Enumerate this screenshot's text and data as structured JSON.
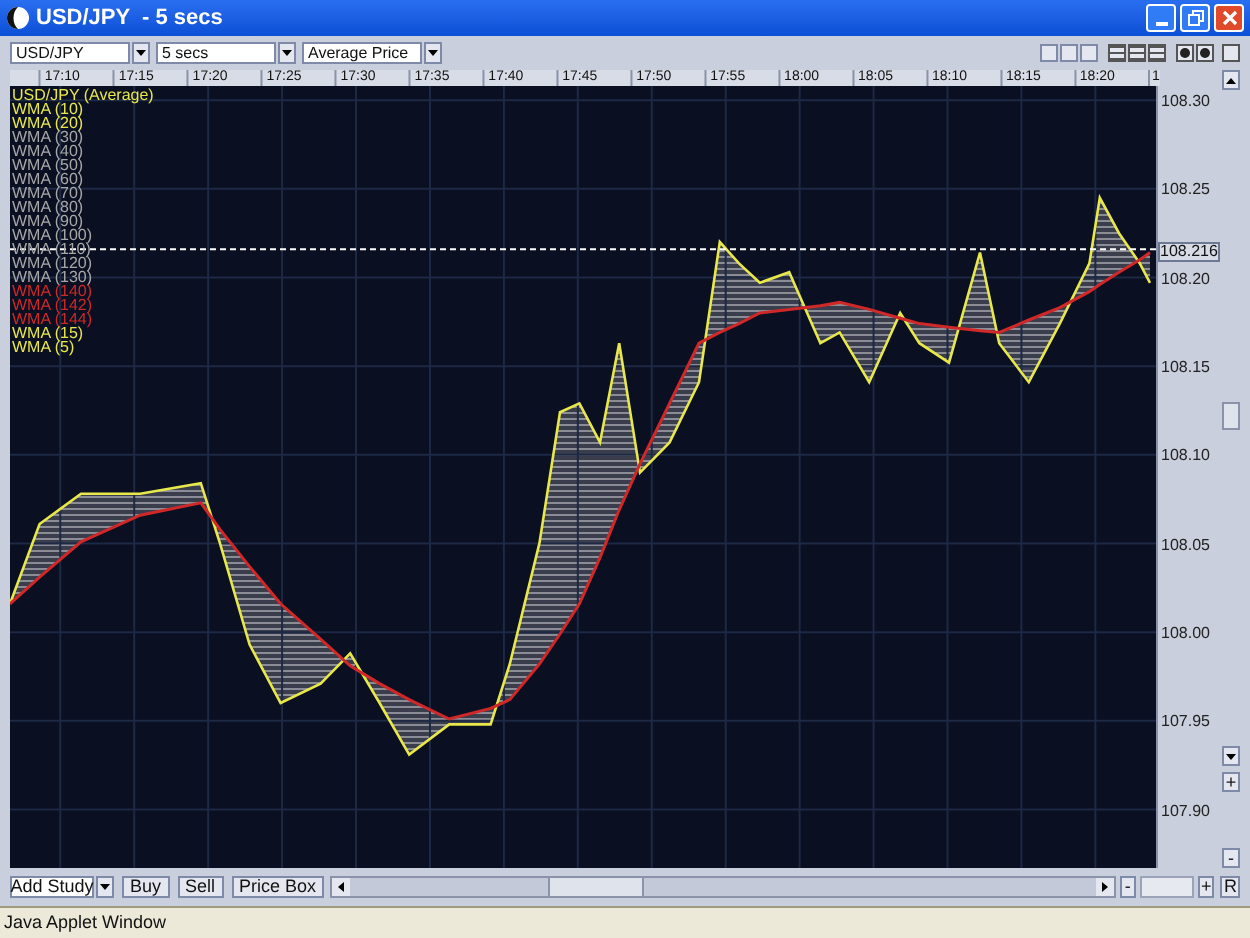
{
  "window": {
    "title": "USD/JPY  - 5 secs"
  },
  "toolbar": {
    "symbol": "USD/JPY",
    "interval": "5 secs",
    "price_type": "Average Price"
  },
  "legend": [
    {
      "kind": "series"
    },
    {
      "kind": "label",
      "label": "WMA (10)",
      "color": "#e8e84a"
    },
    {
      "kind": "label",
      "label": "WMA (20)",
      "color": "#e8e84a"
    },
    {
      "kind": "label",
      "label": "WMA (30)",
      "color": "#a8a8a8"
    },
    {
      "kind": "label",
      "label": "WMA (40)",
      "color": "#a8a8a8"
    },
    {
      "kind": "label",
      "label": "WMA (50)",
      "color": "#a8a8a8"
    },
    {
      "kind": "label",
      "label": "WMA (60)",
      "color": "#a8a8a8"
    },
    {
      "kind": "label",
      "label": "WMA (70)",
      "color": "#a8a8a8"
    },
    {
      "kind": "label",
      "label": "WMA (80)",
      "color": "#a8a8a8"
    },
    {
      "kind": "label",
      "label": "WMA (90)",
      "color": "#a8a8a8"
    },
    {
      "kind": "label",
      "label": "WMA (100)",
      "color": "#a8a8a8"
    },
    {
      "kind": "label",
      "label": "WMA (110)",
      "color": "#a8a8a8"
    },
    {
      "kind": "label",
      "label": "WMA (120)",
      "color": "#a8a8a8"
    },
    {
      "kind": "label",
      "label": "WMA (130)",
      "color": "#a8a8a8"
    },
    {
      "kind": "label",
      "label": "WMA (140)",
      "color": "#d02828"
    },
    {
      "kind": "label",
      "label": "WMA (142)",
      "color": "#d02828"
    },
    {
      "kind": "series"
    },
    {
      "kind": "label",
      "label": "WMA (15)",
      "color": "#e8e84a"
    },
    {
      "kind": "label",
      "label": "WMA (5)",
      "color": "#e8e84a"
    }
  ],
  "chart_data": {
    "type": "line",
    "grid": true,
    "xlim": [
      1026.6,
      1104.1
    ],
    "ylim": [
      107.867,
      108.308
    ],
    "x": [
      1026.6,
      1028.6,
      1031.4,
      1035.4,
      1039.5,
      1040.8,
      1042.8,
      1044.9,
      1047.6,
      1049.6,
      1051.6,
      1053.6,
      1056.3,
      1059.1,
      1060.4,
      1062.4,
      1063.8,
      1065.1,
      1066.5,
      1067.8,
      1069.2,
      1071.2,
      1073.2,
      1074.6,
      1075.9,
      1077.3,
      1079.3,
      1081.4,
      1082.7,
      1084.7,
      1086.8,
      1088.1,
      1090.1,
      1092.2,
      1093.5,
      1095.5,
      1097.6,
      1099.6,
      1100.3,
      1101.6,
      1103.0,
      1103.7
    ],
    "series": [
      {
        "name": "USD/JPY (Average)",
        "color": "#e8e84a",
        "values": [
          108.016,
          108.061,
          108.078,
          108.078,
          108.084,
          108.05,
          107.993,
          107.96,
          107.971,
          107.988,
          107.96,
          107.931,
          107.948,
          107.948,
          107.982,
          108.05,
          108.124,
          108.129,
          108.107,
          108.163,
          108.09,
          108.107,
          108.141,
          108.22,
          108.208,
          108.197,
          108.203,
          108.163,
          108.169,
          108.141,
          108.18,
          108.163,
          108.152,
          108.214,
          108.163,
          108.141,
          108.174,
          108.208,
          108.245,
          108.225,
          108.208,
          108.197
        ]
      },
      {
        "name": "WMA (144)",
        "color": "#d02828",
        "values": [
          108.016,
          108.031,
          108.051,
          108.066,
          108.073,
          108.058,
          108.037,
          108.016,
          107.996,
          107.981,
          107.971,
          107.962,
          107.951,
          107.957,
          107.962,
          107.982,
          107.999,
          108.016,
          108.042,
          108.069,
          108.095,
          108.129,
          108.163,
          108.169,
          108.174,
          108.18,
          108.182,
          108.184,
          108.186,
          108.182,
          108.177,
          108.174,
          108.172,
          108.17,
          108.169,
          108.176,
          108.183,
          108.192,
          108.196,
          108.203,
          108.21,
          108.214
        ]
      }
    ],
    "xticks": [
      {
        "value": 1030,
        "label": "17:10"
      },
      {
        "value": 1035,
        "label": "17:15"
      },
      {
        "value": 1040,
        "label": "17:20"
      },
      {
        "value": 1045,
        "label": "17:25"
      },
      {
        "value": 1050,
        "label": "17:30"
      },
      {
        "value": 1055,
        "label": "17:35"
      },
      {
        "value": 1060,
        "label": "17:40"
      },
      {
        "value": 1065,
        "label": "17:45"
      },
      {
        "value": 1070,
        "label": "17:50"
      },
      {
        "value": 1075,
        "label": "17:55"
      },
      {
        "value": 1080,
        "label": "18:00"
      },
      {
        "value": 1085,
        "label": "18:05"
      },
      {
        "value": 1090,
        "label": "18:10"
      },
      {
        "value": 1095,
        "label": "18:15"
      },
      {
        "value": 1100,
        "label": "18:20"
      }
    ],
    "yticks": [
      {
        "value": 107.9,
        "label": "107.90"
      },
      {
        "value": 107.95,
        "label": "107.95"
      },
      {
        "value": 108.0,
        "label": "108.00"
      },
      {
        "value": 108.05,
        "label": "108.05"
      },
      {
        "value": 108.1,
        "label": "108.10"
      },
      {
        "value": 108.15,
        "label": "108.15"
      },
      {
        "value": 108.2,
        "label": "108.20"
      },
      {
        "value": 108.25,
        "label": "108.25"
      },
      {
        "value": 108.3,
        "label": "108.30"
      }
    ],
    "ref_lines": [
      {
        "axis": "y",
        "value": 108.216,
        "label": "108.216"
      }
    ]
  },
  "time_axis_cut_label": "1",
  "bottom_bar": {
    "buttons": [
      "Add Study",
      "Buy",
      "Sell",
      "Price Box"
    ],
    "zoom_out": "-",
    "zoom_in": "+",
    "reset": "R"
  },
  "status_bar": "Java Applet Window"
}
